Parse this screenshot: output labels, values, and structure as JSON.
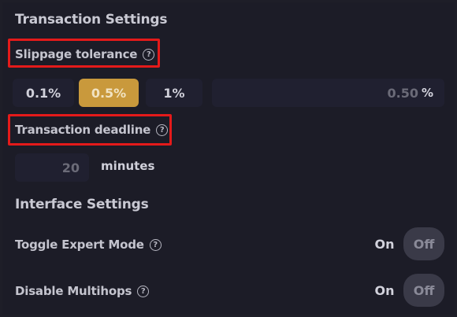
{
  "transaction_settings": {
    "title": "Transaction Settings",
    "slippage_label": "Slippage tolerance",
    "slippage_options": [
      "0.1%",
      "0.5%",
      "1%"
    ],
    "slippage_selected": "0.5%",
    "slippage_value": "0.50",
    "slippage_unit": "%",
    "deadline_label": "Transaction deadline",
    "deadline_value": "20",
    "deadline_unit": "minutes"
  },
  "interface_settings": {
    "title": "Interface Settings",
    "expert_mode_label": "Toggle Expert Mode",
    "multihops_label": "Disable Multihops",
    "on_label": "On",
    "off_label": "Off"
  },
  "colors": {
    "accent": "#c9993c",
    "highlight": "#e41a1a",
    "background": "#1c1c27"
  },
  "icons": {
    "help": "question-circle-icon"
  }
}
